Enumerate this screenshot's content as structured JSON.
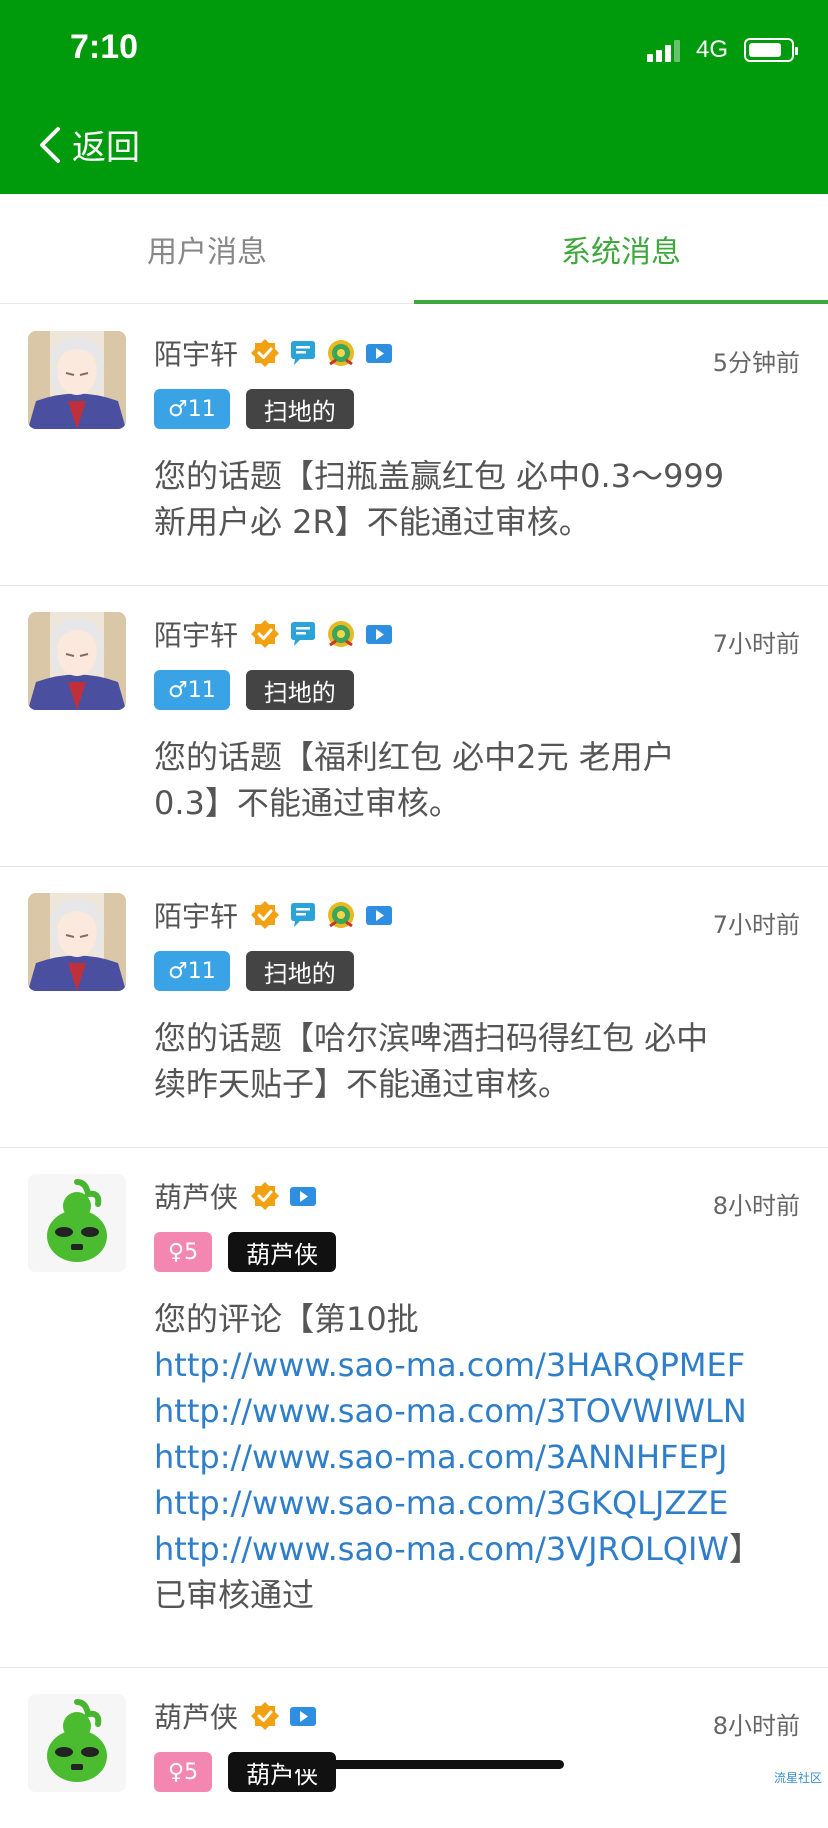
{
  "status_bar": {
    "time": "7:10",
    "network": "4G",
    "battery_level": 0.8
  },
  "nav": {
    "back_label": "返回"
  },
  "tabs": [
    {
      "label": "用户消息",
      "active": false
    },
    {
      "label": "系统消息",
      "active": true
    }
  ],
  "messages": [
    {
      "name": "陌宇轩",
      "time": "5分钟前",
      "level": "♂11",
      "title": "扫地的",
      "content_lines": [
        "您的话题【扫瓶盖赢红包 必中0.3～999",
        "新用户必 2R】不能通过审核。"
      ]
    },
    {
      "name": "陌宇轩",
      "time": "7小时前",
      "level": "♂11",
      "title": "扫地的",
      "content_lines": [
        "您的话题【福利红包 必中2元 老用户",
        "0.3】不能通过审核。"
      ]
    },
    {
      "name": "陌宇轩",
      "time": "7小时前",
      "level": "♂11",
      "title": "扫地的",
      "content_lines": [
        "您的话题【哈尔滨啤酒扫码得红包 必中",
        "续昨天贴子】不能通过审核。"
      ]
    },
    {
      "name": "葫芦侠",
      "time": "8小时前",
      "level": "♀5",
      "title": "葫芦侠",
      "content_prefix": "您的评论【第10批",
      "links": [
        "http://www.sao-ma.com/3HARQPMEF",
        "http://www.sao-ma.com/3TOVWIWLN",
        "http://www.sao-ma.com/3ANNHFEPJ",
        "http://www.sao-ma.com/3GKQLJZZE",
        "http://www.sao-ma.com/3VJROLQIW"
      ],
      "link_suffix": "】",
      "content_suffix": "已审核通过"
    },
    {
      "name": "葫芦侠",
      "time": "8小时前",
      "level": "♀5",
      "title": "葫芦侠"
    }
  ],
  "watermark": "流星社区",
  "colors": {
    "header": "#009a0d",
    "active_tab": "#3ea83e",
    "link": "#2f7ec9",
    "male_badge": "#3aa3e6",
    "female_badge": "#f487b1"
  }
}
